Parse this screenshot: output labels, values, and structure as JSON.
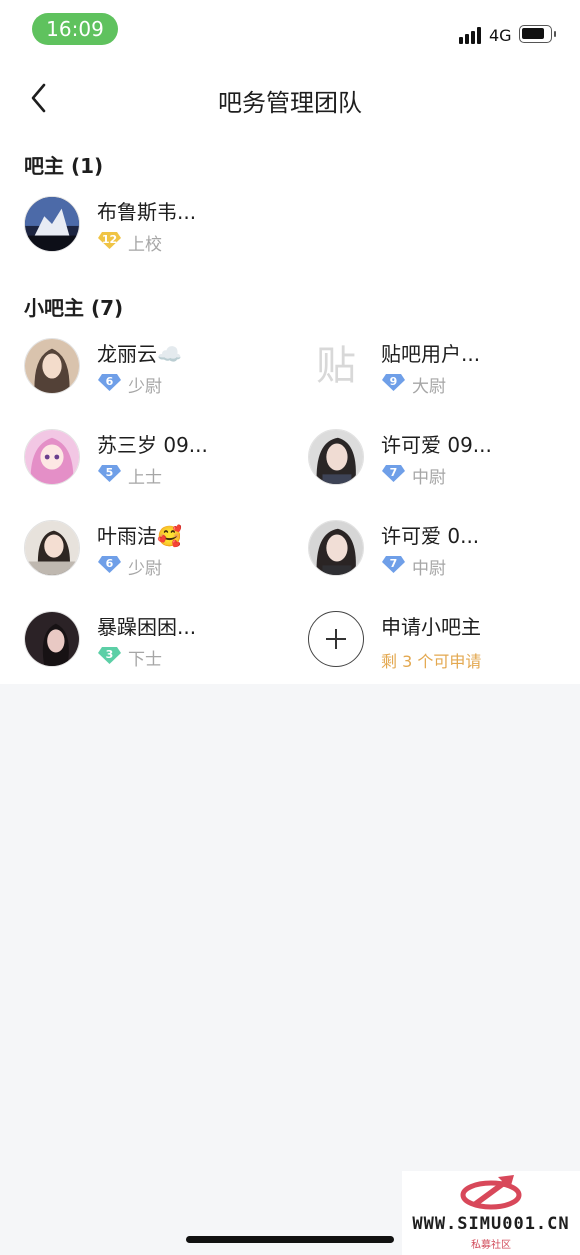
{
  "status_bar": {
    "time": "16:09",
    "network": "4G"
  },
  "header": {
    "title": "吧务管理团队"
  },
  "owner_section": {
    "title": "吧主 (1)",
    "members": [
      {
        "name": "布鲁斯韦...",
        "level": "12",
        "rank": "上校",
        "gem_color": "#f0c445"
      }
    ]
  },
  "sub_section": {
    "title": "小吧主 (7)",
    "members": [
      {
        "name": "龙丽云☁️",
        "level": "6",
        "rank": "少尉",
        "gem_color": "#6f9fe8"
      },
      {
        "name": "贴吧用户...",
        "level": "9",
        "rank": "大尉",
        "gem_color": "#6f9fe8",
        "avatar_glyph": "贴"
      },
      {
        "name": "苏三岁 09...",
        "level": "5",
        "rank": "上士",
        "gem_color": "#6f9fe8"
      },
      {
        "name": "许可爱 09...",
        "level": "7",
        "rank": "中尉",
        "gem_color": "#6f9fe8"
      },
      {
        "name": "叶雨洁🥰",
        "level": "6",
        "rank": "少尉",
        "gem_color": "#6f9fe8"
      },
      {
        "name": "许可爱 0...",
        "level": "7",
        "rank": "中尉",
        "gem_color": "#6f9fe8"
      },
      {
        "name": "暴躁困困...",
        "level": "3",
        "rank": "下士",
        "gem_color": "#5ccfa6"
      }
    ],
    "apply": {
      "label": "申请小吧主",
      "sub": "剩 3 个可申请"
    }
  },
  "watermark": {
    "text": "WWW.SIMU001.CN",
    "sub": "私募社区"
  }
}
